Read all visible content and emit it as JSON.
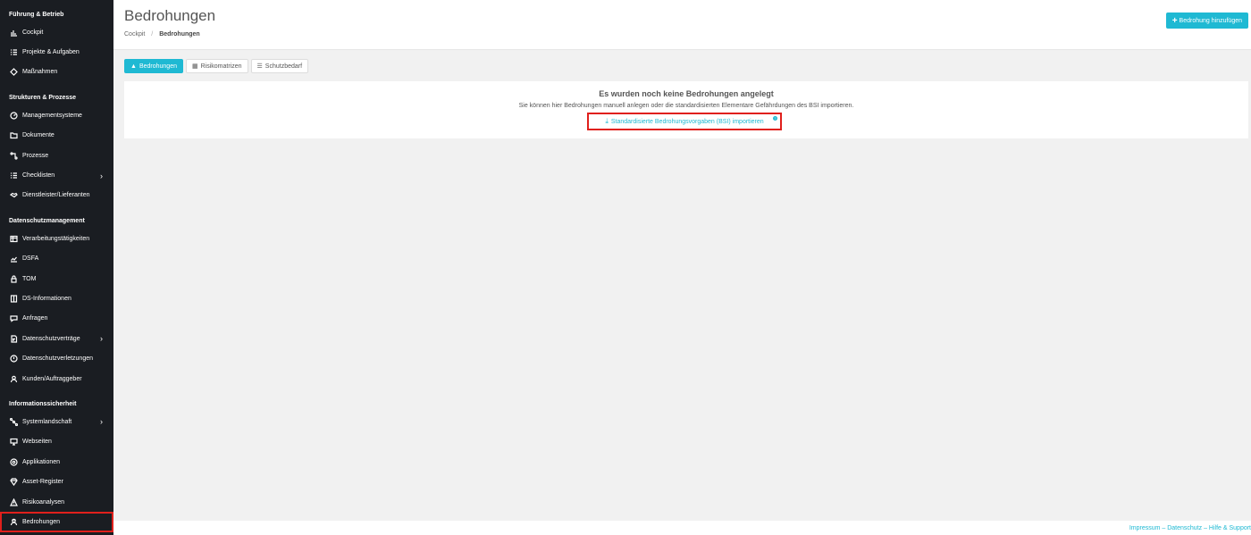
{
  "sidebar": {
    "sections": [
      {
        "title": "Führung & Betrieb",
        "items": [
          {
            "label": "Cockpit",
            "icon": "chart-bar-icon"
          },
          {
            "label": "Projekte & Aufgaben",
            "icon": "list-check-icon"
          },
          {
            "label": "Maßnahmen",
            "icon": "diamond-icon"
          }
        ]
      },
      {
        "title": "Strukturen & Prozesse",
        "items": [
          {
            "label": "Managementsysteme",
            "icon": "gauge-icon"
          },
          {
            "label": "Dokumente",
            "icon": "folder-icon"
          },
          {
            "label": "Prozesse",
            "icon": "flow-icon"
          },
          {
            "label": "Checklisten",
            "icon": "list-icon",
            "chevron": true
          },
          {
            "label": "Dienstleister/Lieferanten",
            "icon": "handshake-icon"
          }
        ]
      },
      {
        "title": "Datenschutzmanagement",
        "items": [
          {
            "label": "Verarbeitungstätigkeiten",
            "icon": "table-icon"
          },
          {
            "label": "DSFA",
            "icon": "chart-line-icon"
          },
          {
            "label": "TOM",
            "icon": "lock-icon"
          },
          {
            "label": "DS-Informationen",
            "icon": "book-icon"
          },
          {
            "label": "Anfragen",
            "icon": "chat-icon"
          },
          {
            "label": "Datenschutzverträge",
            "icon": "contract-icon",
            "chevron": true
          },
          {
            "label": "Datenschutzverletzungen",
            "icon": "alert-circle-icon"
          },
          {
            "label": "Kunden/Auftraggeber",
            "icon": "user-icon"
          }
        ]
      },
      {
        "title": "Informationssicherheit",
        "items": [
          {
            "label": "Systemlandschaft",
            "icon": "network-icon",
            "chevron": true
          },
          {
            "label": "Webseiten",
            "icon": "monitor-icon"
          },
          {
            "label": "Applikationen",
            "icon": "app-icon"
          },
          {
            "label": "Asset-Register",
            "icon": "gem-icon"
          },
          {
            "label": "Risikoanalysen",
            "icon": "warning-icon"
          },
          {
            "label": "Bedrohungen",
            "icon": "user-secret-icon",
            "active": true
          }
        ]
      }
    ]
  },
  "header": {
    "title": "Bedrohungen",
    "breadcrumb": [
      "Cockpit",
      "Bedrohungen"
    ],
    "add_button": "Bedrohung hinzufügen"
  },
  "tabs": [
    {
      "label": "Bedrohungen",
      "icon": "warning-icon",
      "active": true
    },
    {
      "label": "Risikomatrizen",
      "icon": "grid-icon",
      "active": false
    },
    {
      "label": "Schutzbedarf",
      "icon": "list-icon",
      "active": false
    }
  ],
  "empty_state": {
    "title": "Es wurden noch keine Bedrohungen angelegt",
    "text": "Sie können hier Bedrohungen manuell anlegen oder die standardisierten Elementare Gefährdungen des BSI importieren.",
    "import_link": "Standardisierte Bedrohungsvorgaben (BSI) importieren",
    "help_glyph": "?"
  },
  "footer": {
    "links": "Impressum – Datenschutz – Hilfe & Support"
  },
  "colors": {
    "accent": "#1fb9d3",
    "sidebar_bg": "#1a1d22",
    "highlight": "#e0201c"
  }
}
